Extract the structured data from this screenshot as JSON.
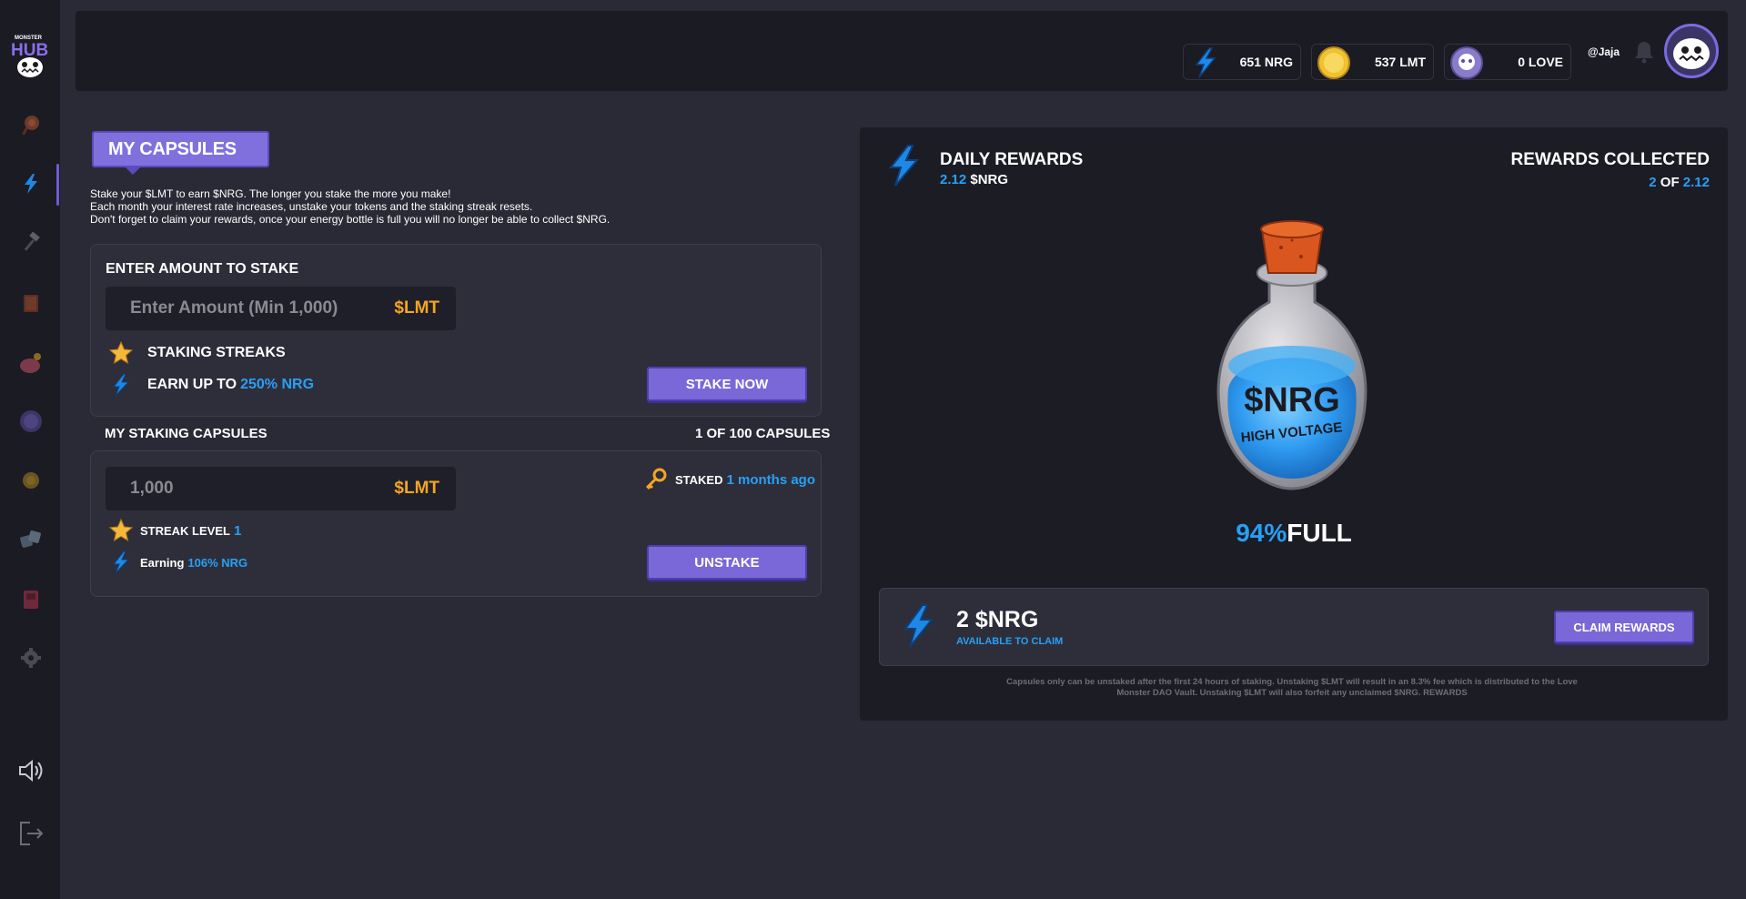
{
  "brand": {
    "logo_text": "MONSTER HUB"
  },
  "sidebar": {
    "items": [
      {
        "name": "home",
        "icon": "candy-icon"
      },
      {
        "name": "staking",
        "icon": "lightning-icon",
        "active": true
      },
      {
        "name": "tools",
        "icon": "hammer-icon"
      },
      {
        "name": "book",
        "icon": "book-icon"
      },
      {
        "name": "piggy-bank",
        "icon": "piggy-bank-icon"
      },
      {
        "name": "love",
        "icon": "monster-coin-icon"
      },
      {
        "name": "coin",
        "icon": "coin-icon"
      },
      {
        "name": "dice",
        "icon": "dice-icon"
      },
      {
        "name": "arcade",
        "icon": "arcade-icon"
      },
      {
        "name": "settings",
        "icon": "gear-icon"
      }
    ],
    "volume_icon": "speaker-icon",
    "logout_icon": "logout-icon"
  },
  "header": {
    "nrg": "651 NRG",
    "lmt": "537 LMT",
    "love": "0 LOVE",
    "username": "@Jaja"
  },
  "capsules": {
    "title": "MY CAPSULES",
    "intro": [
      "Stake your $LMT to earn $NRG. The longer you stake the more you make!",
      "Each month your interest rate increases, unstake your tokens and the staking streak resets.",
      "Don't forget to claim your rewards, once your energy bottle is full you will no longer be able to collect $NRG."
    ],
    "stake": {
      "heading": "ENTER AMOUNT TO STAKE",
      "placeholder": "Enter Amount (Min 1,000)",
      "unit": "$LMT",
      "streaks_label": "STAKING STREAKS",
      "earn_prefix": "EARN UP TO ",
      "earn_value": "250% NRG",
      "button": "STAKE NOW"
    },
    "staking": {
      "heading": "MY STAKING CAPSULES",
      "count": "1 OF 100 CAPSULES",
      "amount": "1,000",
      "unit": "$LMT",
      "staked_label": "STAKED ",
      "staked_when": "1 months ago",
      "streak_label": "STREAK LEVEL ",
      "streak_value": "1",
      "earning_label": "Earning ",
      "earning_value": "106% NRG",
      "button": "UNSTAKE"
    }
  },
  "rewards": {
    "daily_title": "DAILY REWARDS",
    "daily_value": "2.12",
    "daily_unit": " $NRG",
    "collected_title": "REWARDS COLLECTED",
    "collected_value": "2",
    "collected_of": " OF ",
    "collected_total": "2.12",
    "bottle_label": "$NRG",
    "bottle_sub": "HIGH VOLTAGE",
    "fill_percent": "94%",
    "fill_label": "FULL",
    "fill_fraction": 0.94,
    "claim_amount": "2 $NRG",
    "claim_sub": "AVAILABLE TO CLAIM",
    "claim_button": "CLAIM REWARDS",
    "disclaimer": "Capsules only can be unstaked after the first 24 hours of staking. Unstaking $LMT will result in an 8.3% fee which is distributed to the Love Monster DAO Vault. Unstaking $LMT will also forfeit any unclaimed $NRG. REWARDS"
  },
  "colors": {
    "accent": "#7a68d8",
    "blue": "#27a0f5",
    "gold": "#f5a623",
    "panel": "#2e2e3a",
    "dark": "#1b1b24"
  }
}
